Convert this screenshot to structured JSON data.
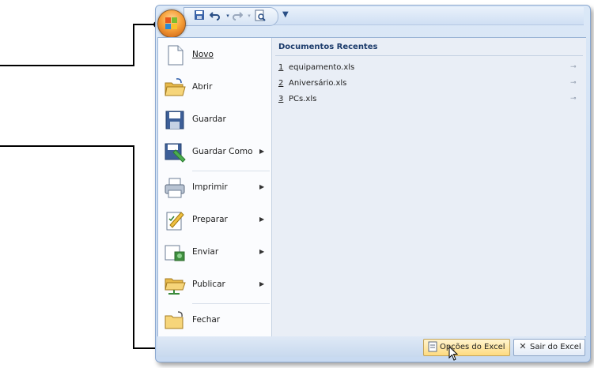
{
  "quick_access": {
    "icons": [
      "save-icon",
      "undo-icon",
      "redo-icon",
      "print-preview-icon"
    ],
    "customize_glyph": "▼"
  },
  "menu": {
    "items": [
      {
        "label": "Novo",
        "icon": "new-document-icon",
        "submenu": false
      },
      {
        "label": "Abrir",
        "icon": "open-folder-icon",
        "submenu": false
      },
      {
        "label": "Guardar",
        "icon": "save-disk-icon",
        "submenu": false
      },
      {
        "label": "Guardar Como",
        "icon": "save-as-icon",
        "submenu": true
      },
      {
        "label": "Imprimir",
        "icon": "printer-icon",
        "submenu": true
      },
      {
        "label": "Preparar",
        "icon": "prepare-icon",
        "submenu": true
      },
      {
        "label": "Enviar",
        "icon": "send-icon",
        "submenu": true
      },
      {
        "label": "Publicar",
        "icon": "publish-icon",
        "submenu": true
      },
      {
        "label": "Fechar",
        "icon": "close-folder-icon",
        "submenu": false
      }
    ]
  },
  "recent": {
    "title": "Documentos Recentes",
    "files": [
      {
        "num": "1",
        "name": "equipamento.xls"
      },
      {
        "num": "2",
        "name": "Aniversário.xls"
      },
      {
        "num": "3",
        "name": "PCs.xls"
      }
    ]
  },
  "footer": {
    "options_label": "Opções do Excel",
    "exit_label": "Sair do Excel"
  },
  "colors": {
    "accent": "#f7a13a",
    "panel": "#e9eef6",
    "frame": "#c8daf1"
  }
}
